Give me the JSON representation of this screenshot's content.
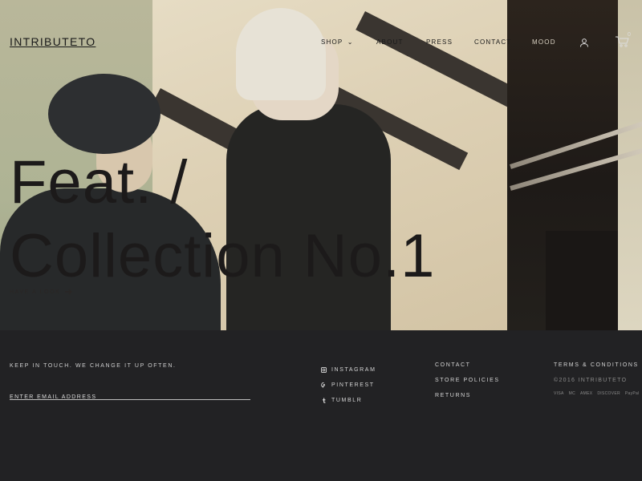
{
  "brand": "INTRIBUTETO",
  "nav": {
    "items": [
      {
        "label": "SHOP",
        "has_dropdown": true,
        "arrow": "⌄"
      },
      {
        "label": "ABOUT"
      },
      {
        "label": "PRESS"
      },
      {
        "label": "CONTACT"
      },
      {
        "label": "MOOD"
      }
    ],
    "icons": [
      "user-icon",
      "cart-icon"
    ],
    "cart_count": "0"
  },
  "hero": {
    "title_line1": "Feat. /",
    "title_line2": "Collection No.1",
    "cta": "HAVE A LOOK"
  },
  "footer": {
    "tagline": "KEEP IN TOUCH. WE CHANGE IT UP OFTEN.",
    "email_placeholder": "ENTER EMAIL ADDRESS",
    "social": [
      {
        "label": "INSTAGRAM",
        "icon": "instagram-icon"
      },
      {
        "label": "PINTEREST",
        "icon": "pinterest-icon"
      },
      {
        "label": "TUMBLR",
        "icon": "tumblr-icon"
      }
    ],
    "links": [
      "CONTACT",
      "STORE POLICIES",
      "RETURNS"
    ],
    "terms": "TERMS & CONDITIONS",
    "copyright": "©2016 INTRIBUTETO",
    "payments": [
      "VISA",
      "MC",
      "AMEX",
      "DISCOVER",
      "PayPal"
    ]
  },
  "colors": {
    "text_dark": "#1c1a1a",
    "footer_bg": "#222224",
    "footer_text": "#d4d4d4"
  }
}
